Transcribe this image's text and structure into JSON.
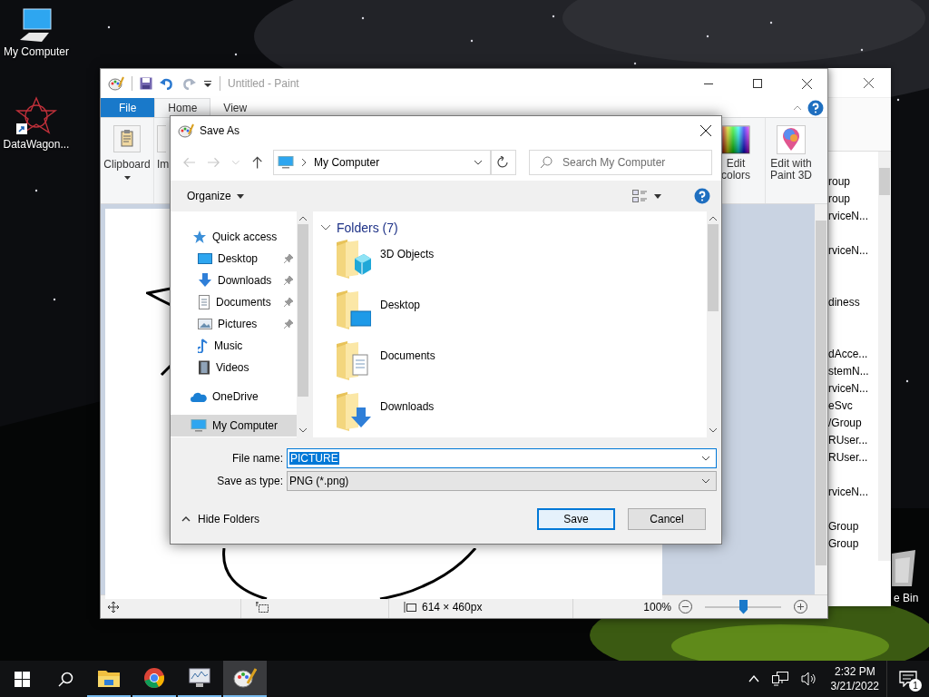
{
  "desktop": {
    "icons": [
      {
        "label": "My Computer",
        "kind": "computer"
      },
      {
        "label": "DataWagon...",
        "kind": "shortcut"
      },
      {
        "label": "e Bin",
        "kind": "recycle"
      }
    ]
  },
  "back_window": {
    "rows": [
      {
        "kind": "text",
        "text": "roup"
      },
      {
        "kind": "text",
        "text": "roup"
      },
      {
        "kind": "text",
        "text": "rviceN..."
      },
      {
        "kind": "blank"
      },
      {
        "kind": "text",
        "text": "rviceN..."
      },
      {
        "kind": "blank"
      },
      {
        "kind": "blank"
      },
      {
        "kind": "text",
        "text": "diness"
      },
      {
        "kind": "blank"
      },
      {
        "kind": "blank"
      },
      {
        "kind": "text",
        "text": "dAcce..."
      },
      {
        "kind": "text",
        "text": "stemN..."
      },
      {
        "kind": "text",
        "text": "rviceN..."
      },
      {
        "kind": "text",
        "text": "eSvc"
      },
      {
        "kind": "text",
        "text": "/Group"
      },
      {
        "kind": "text",
        "text": "RUser..."
      },
      {
        "kind": "text",
        "text": "RUser..."
      },
      {
        "kind": "blank"
      },
      {
        "kind": "text",
        "text": "rviceN..."
      },
      {
        "kind": "blank"
      },
      {
        "kind": "text",
        "text": "Group"
      },
      {
        "kind": "text",
        "text": "Group"
      }
    ]
  },
  "paint": {
    "title": "Untitled - Paint",
    "tabs": [
      {
        "label": "File",
        "kind": "menu",
        "selected": false
      },
      {
        "label": "Home",
        "kind": "tab",
        "selected": true
      },
      {
        "label": "View",
        "kind": "tab",
        "selected": false
      }
    ],
    "ribbon_left": [
      {
        "label": "Clipboard",
        "kind": "clipboard"
      },
      {
        "label": "Im",
        "kind": "cut"
      }
    ],
    "ribbon_right": [
      {
        "label": "Edit colors",
        "kind": "colors"
      },
      {
        "label": "Edit with Paint 3D",
        "kind": "paint3d"
      }
    ],
    "status": {
      "size": "614 × 460px",
      "zoom": "100%",
      "level": 0.5
    }
  },
  "dialog": {
    "title": "Save As",
    "address": "My Computer",
    "search_placeholder": "Search My Computer",
    "organize": "Organize",
    "nav": [
      {
        "label": "Quick access",
        "kind": "star",
        "selected": false,
        "children": [
          {
            "label": "Desktop",
            "kind": "desktop",
            "pinned": true,
            "selected": false
          },
          {
            "label": "Downloads",
            "kind": "downloads",
            "pinned": true,
            "selected": false
          },
          {
            "label": "Documents",
            "kind": "documents",
            "pinned": true,
            "selected": false
          },
          {
            "label": "Pictures",
            "kind": "pictures",
            "pinned": true,
            "selected": false
          },
          {
            "label": "Music",
            "kind": "music",
            "pinned": false,
            "selected": false
          },
          {
            "label": "Videos",
            "kind": "videos",
            "pinned": false,
            "selected": false
          }
        ]
      },
      {
        "label": "OneDrive",
        "kind": "cloud",
        "selected": false
      },
      {
        "label": "My Computer",
        "kind": "computer",
        "selected": true
      }
    ],
    "group": {
      "label": "Folders (7)",
      "expanded": true
    },
    "folders": [
      {
        "name": "3D Objects",
        "kind": "objects"
      },
      {
        "name": "Desktop",
        "kind": "desktop"
      },
      {
        "name": "Documents",
        "kind": "documents"
      },
      {
        "name": "Downloads",
        "kind": "downloads"
      }
    ],
    "file_name_label": "File name:",
    "file_name": "PICTURE",
    "type_label": "Save as type:",
    "save_type": "PNG (*.png)",
    "hide_folders": "Hide Folders",
    "buttons": [
      {
        "label": "Save",
        "default": true
      },
      {
        "label": "Cancel",
        "default": false
      }
    ]
  },
  "taskbar": {
    "apps": [
      {
        "kind": "explorer",
        "selected": false
      },
      {
        "kind": "chrome",
        "selected": false
      },
      {
        "kind": "monitor",
        "selected": false
      },
      {
        "kind": "paint",
        "selected": true
      }
    ],
    "time": "2:32 PM",
    "date": "3/21/2022",
    "notifications": "1"
  }
}
